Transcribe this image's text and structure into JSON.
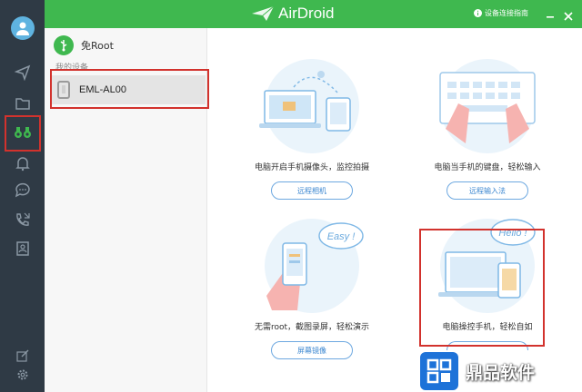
{
  "app": {
    "title": "AirDroid"
  },
  "header": {
    "guide_label": "设备连接指南",
    "icons": [
      "info-icon",
      "minimize-icon",
      "close-icon"
    ]
  },
  "sidebar": {
    "icons": [
      "avatar",
      "send-icon",
      "folder-icon",
      "binoculars-icon",
      "bell-icon",
      "chat-icon",
      "call-icon",
      "contacts-icon",
      "edit-icon",
      "settings-icon"
    ],
    "active": "binoculars-icon"
  },
  "device_panel": {
    "root_label": "免Root",
    "section_label": "我的设备",
    "device_name": "EML-AL00"
  },
  "features": [
    {
      "caption": "电脑开启手机摄像头，监控拍摄",
      "button": "远程相机",
      "illustration": "camera-monitor-illustration"
    },
    {
      "caption": "电脑当手机的键盘，轻松输入",
      "button": "远程输入法",
      "illustration": "keyboard-illustration"
    },
    {
      "caption": "无需root，截图录屏，轻松演示",
      "button": "屏幕镜像",
      "illustration": "screen-mirror-illustration",
      "bubble_text": "Easy !"
    },
    {
      "caption": "电脑操控手机，轻松自如",
      "button": "",
      "illustration": "remote-control-illustration",
      "bubble_text": "Hello !"
    }
  ],
  "watermark": {
    "text": "鼎品软件"
  },
  "colors": {
    "brand_green": "#3fb84f",
    "rail_dark": "#2f3a45",
    "accent_blue": "#3a86d0",
    "highlight_red": "#d2322d"
  }
}
